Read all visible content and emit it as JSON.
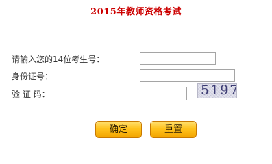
{
  "title": "2015年教师资格考试",
  "form": {
    "exam_id_label": "请输入您的14位考生号：",
    "exam_id_value": "",
    "id_card_label": "身份证号：",
    "id_card_value": "",
    "captcha_label": "验 证 码：",
    "captcha_value": "",
    "captcha_image_text": "5197"
  },
  "buttons": {
    "confirm_label": "确定",
    "reset_label": "重置"
  },
  "colors": {
    "title": "#cc0000",
    "button_fill": "#ffc21d",
    "captcha_text": "#3b3b72"
  }
}
